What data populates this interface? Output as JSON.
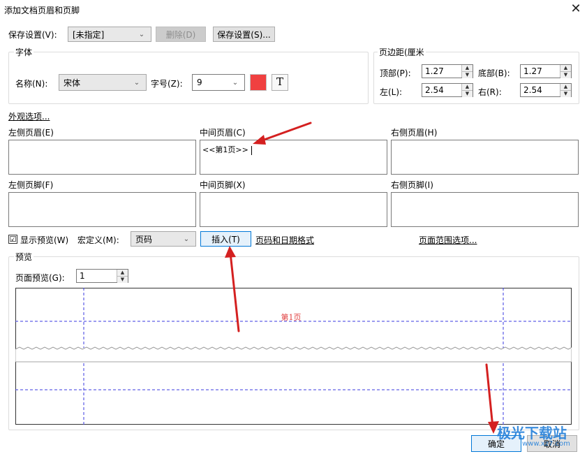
{
  "window": {
    "title": "添加文档页眉和页脚"
  },
  "save": {
    "label": "保存设置(V):",
    "selected": "[未指定]",
    "delete_label": "删除(D)",
    "save_label": "保存设置(S)..."
  },
  "font": {
    "group_title": "字体",
    "name_label": "名称(N):",
    "name_value": "宋体",
    "size_label": "字号(Z):",
    "size_value": "9",
    "color": "#f04040",
    "text_icon": "T"
  },
  "margins": {
    "group_title": "页边距(厘米",
    "top_label": "顶部(P):",
    "top_value": "1.27",
    "bottom_label": "底部(B):",
    "bottom_value": "1.27",
    "left_label": "左(L):",
    "left_value": "2.54",
    "right_label": "右(R):",
    "right_value": "2.54"
  },
  "appearance_link": "外观选项...",
  "header": {
    "left_label": "左侧页眉(E)",
    "center_label": "中间页眉(C)",
    "center_value": "<<第1页>>",
    "right_label": "右侧页眉(H)"
  },
  "footer": {
    "left_label": "左侧页脚(F)",
    "center_label": "中间页脚(X)",
    "right_label": "右侧页脚(I)"
  },
  "options": {
    "show_preview_label": "显示预览(W)",
    "show_preview_checked": "☑",
    "macro_label": "宏定义(M):",
    "macro_value": "页码",
    "insert_label": "插入(T)",
    "format_link": "页码和日期格式",
    "range_link": "页面范围选项..."
  },
  "preview": {
    "group_title": "预览",
    "page_label": "页面预览(G):",
    "page_value": "1",
    "header_text": "第1页",
    "header_text_color": "#e04040",
    "guide_color": "#3a3ae0"
  },
  "buttons": {
    "ok": "确定",
    "cancel": "取消"
  },
  "watermark": {
    "text": "极光下载站",
    "url": "www.xz7.com"
  },
  "annotation_color": "#d42020"
}
